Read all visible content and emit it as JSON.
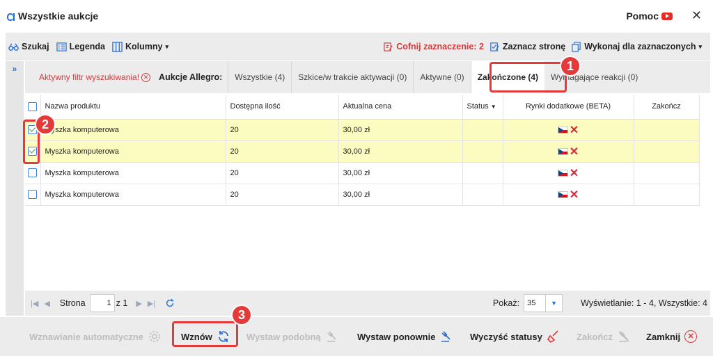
{
  "window": {
    "title": "Wszystkie aukcje",
    "help_label": "Pomoc",
    "close_symbol": "✕"
  },
  "toolbar": {
    "search_label": "Szukaj",
    "legend_label": "Legenda",
    "columns_label": "Kolumny",
    "undo_selection_label": "Cofnij zaznaczenie: 2",
    "select_page_label": "Zaznacz stronę",
    "bulk_action_label": "Wykonaj dla zaznaczonych"
  },
  "side_panel": {
    "expand_symbol": "»"
  },
  "filterbar": {
    "active_filter_label": "Aktywny filtr wyszukiwania!",
    "group_label": "Aukcje Allegro:",
    "tabs": [
      {
        "label": "Wszystkie (4)"
      },
      {
        "label": "Szkice/w trakcie aktywacji (0)"
      },
      {
        "label": "Aktywne (0)"
      },
      {
        "label": "Zakończone (4)"
      },
      {
        "label": "Wymagające reakcji (0)"
      }
    ]
  },
  "grid": {
    "columns": [
      "Nazwa produktu",
      "Dostępna ilość",
      "Aktualna cena",
      "Status",
      "Rynki dodatkowe (BETA)",
      "Zakończ"
    ],
    "rows": [
      {
        "checked": true,
        "name": "Myszka komputerowa",
        "qty": "20",
        "price": "30,00 zł",
        "status": "",
        "market_icon": "czech-flag-icon"
      },
      {
        "checked": true,
        "name": "Myszka komputerowa",
        "qty": "20",
        "price": "30,00 zł",
        "status": "",
        "market_icon": "czech-flag-icon"
      },
      {
        "checked": false,
        "name": "Myszka komputerowa",
        "qty": "20",
        "price": "30,00 zł",
        "status": "",
        "market_icon": "czech-flag-icon"
      },
      {
        "checked": false,
        "name": "Myszka komputerowa",
        "qty": "20",
        "price": "30,00 zł",
        "status": "",
        "market_icon": "czech-flag-icon"
      }
    ]
  },
  "pager": {
    "page_label": "Strona",
    "page_value": "1",
    "page_of": "z 1",
    "show_label": "Pokaż:",
    "page_size": "35",
    "count_label": "Wyświetlanie: 1 - 4, Wszystkie: 4"
  },
  "footer": {
    "auto_renew_label": "Wznawianie automatyczne",
    "renew_label": "Wznów",
    "list_similar_label": "Wystaw podobną",
    "relist_label": "Wystaw ponownie",
    "clear_status_label": "Wyczyść statusy",
    "end_label": "Zakończ",
    "close_label": "Zamknij"
  },
  "annotations": {
    "badge1": "1",
    "badge2": "2",
    "badge3": "3"
  },
  "colors": {
    "accent_blue": "#2a6fd6",
    "highlight_red": "#e53a3a",
    "selected_row": "#fcfcc0"
  }
}
